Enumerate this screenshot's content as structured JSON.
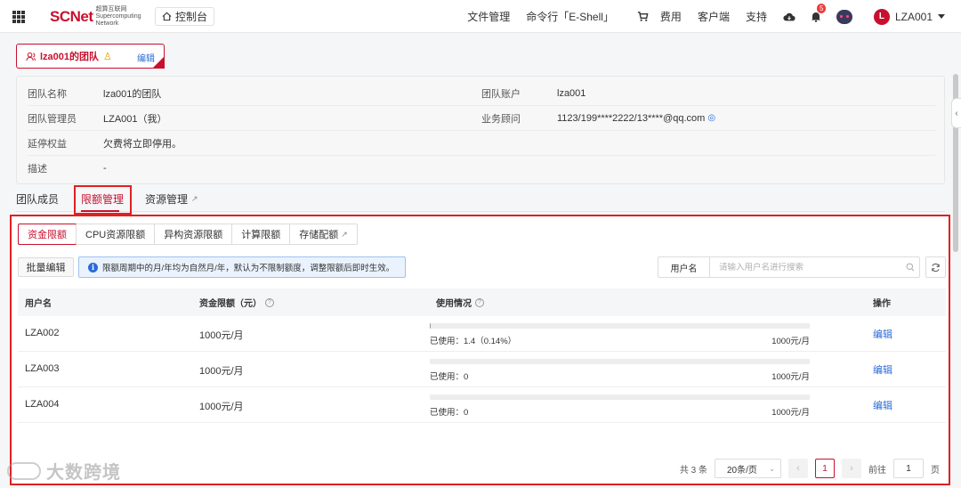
{
  "header": {
    "logo_main": "SCNet",
    "logo_sub": "超算互联网 Supercomputing Network",
    "console_label": "控制台",
    "nav": [
      "文件管理",
      "命令行「E-Shell」",
      "费用",
      "客户端",
      "支持"
    ],
    "notification_count": "5",
    "user_initial": "L",
    "user_name": "LZA001"
  },
  "team": {
    "name": "lza001的团队",
    "edit_label": "编辑"
  },
  "info": {
    "team_name_label": "团队名称",
    "team_name_value": "lza001的团队",
    "team_account_label": "团队账户",
    "team_account_value": "lza001",
    "admin_label": "团队管理员",
    "admin_value": "LZA001（我）",
    "advisor_label": "业务顾问",
    "advisor_value": "1123/199****2222/13****@qq.com",
    "extension_label": "延停权益",
    "extension_value": "欠费将立即停用。",
    "desc_label": "描述",
    "desc_value": "-"
  },
  "main_tabs": {
    "members": "团队成员",
    "quota": "限额管理",
    "resources": "资源管理"
  },
  "sub_tabs": [
    "资金限额",
    "CPU资源限额",
    "异构资源限额",
    "计算限额",
    "存储配额"
  ],
  "toolbar": {
    "batch_edit": "批量编辑",
    "notice": "限额周期中的月/年均为自然月/年，默认为不限制额度，调整限额后即时生效。",
    "search_label": "用户名",
    "search_placeholder": "请输入用户名进行搜索"
  },
  "table": {
    "columns": [
      "用户名",
      "资金限额（元）",
      "使用情况",
      "操作"
    ],
    "rows": [
      {
        "user": "LZA002",
        "limit": "1000元/月",
        "used": "已使用：1.4（0.14%）",
        "cap": "1000元/月",
        "fraction": 0.0014,
        "action": "编辑"
      },
      {
        "user": "LZA003",
        "limit": "1000元/月",
        "used": "已使用：0",
        "cap": "1000元/月",
        "fraction": 0,
        "action": "编辑"
      },
      {
        "user": "LZA004",
        "limit": "1000元/月",
        "used": "已使用：0",
        "cap": "1000元/月",
        "fraction": 0,
        "action": "编辑"
      }
    ]
  },
  "pagination": {
    "total": "共 3 条",
    "page_size": "20条/页",
    "current_page": "1",
    "goto_label": "前往",
    "goto_value": "1",
    "page_suffix": "页"
  },
  "watermark": "大数跨境",
  "colors": {
    "brand": "#c8102e",
    "link": "#2a6cd6",
    "highlight": "#e12020"
  }
}
